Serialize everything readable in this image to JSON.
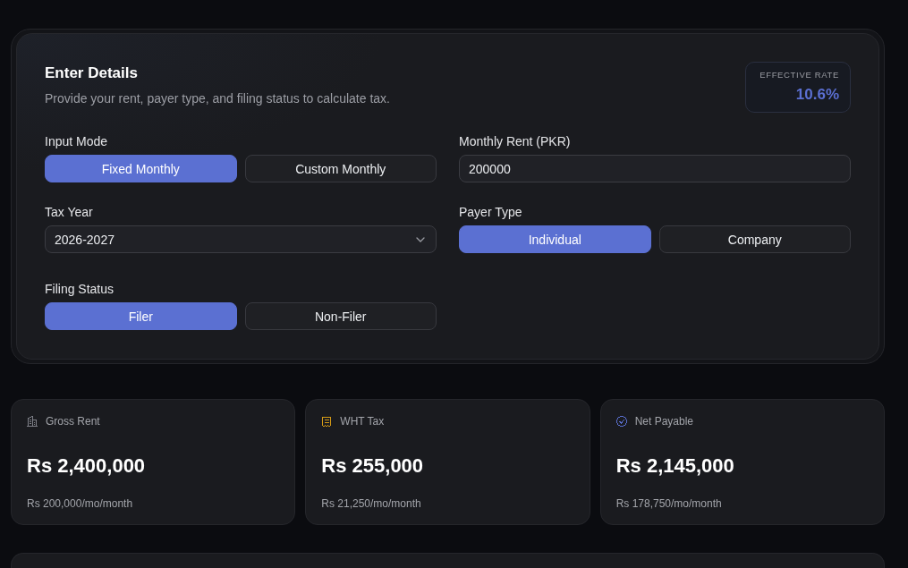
{
  "details": {
    "title": "Enter Details",
    "subtitle": "Provide your rent, payer type, and filing status to calculate tax.",
    "effective_rate": {
      "label": "EFFECTIVE RATE",
      "value": "10.6%"
    },
    "input_mode": {
      "label": "Input Mode",
      "options": [
        {
          "label": "Fixed Monthly",
          "selected": true
        },
        {
          "label": "Custom Monthly",
          "selected": false
        }
      ]
    },
    "monthly_rent": {
      "label": "Monthly Rent (PKR)",
      "value": "200000"
    },
    "tax_year": {
      "label": "Tax Year",
      "value": "2026-2027"
    },
    "payer_type": {
      "label": "Payer Type",
      "options": [
        {
          "label": "Individual",
          "selected": true
        },
        {
          "label": "Company",
          "selected": false
        }
      ]
    },
    "filing_status": {
      "label": "Filing Status",
      "options": [
        {
          "label": "Filer",
          "selected": true
        },
        {
          "label": "Non-Filer",
          "selected": false
        }
      ]
    }
  },
  "stats": [
    {
      "label": "Gross Rent",
      "value": "Rs 2,400,000",
      "sub": "Rs 200,000/mo/month",
      "color": "#7f8189"
    },
    {
      "label": "WHT Tax",
      "value": "Rs 255,000",
      "sub": "Rs 21,250/mo/month",
      "color": "#d49a16"
    },
    {
      "label": "Net Payable",
      "value": "Rs 2,145,000",
      "sub": "Rs 178,750/mo/month",
      "color": "#5a6fd0"
    }
  ]
}
